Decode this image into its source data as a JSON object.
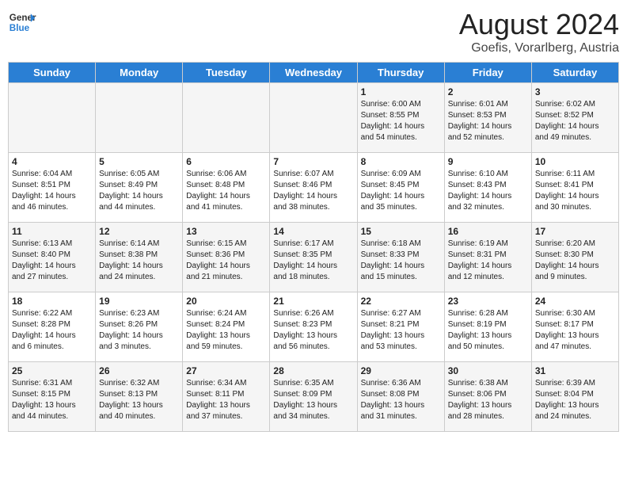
{
  "header": {
    "logo_line1": "General",
    "logo_line2": "Blue",
    "title": "August 2024",
    "subtitle": "Goefis, Vorarlberg, Austria"
  },
  "weekdays": [
    "Sunday",
    "Monday",
    "Tuesday",
    "Wednesday",
    "Thursday",
    "Friday",
    "Saturday"
  ],
  "weeks": [
    [
      {
        "day": "",
        "info": ""
      },
      {
        "day": "",
        "info": ""
      },
      {
        "day": "",
        "info": ""
      },
      {
        "day": "",
        "info": ""
      },
      {
        "day": "1",
        "info": "Sunrise: 6:00 AM\nSunset: 8:55 PM\nDaylight: 14 hours\nand 54 minutes."
      },
      {
        "day": "2",
        "info": "Sunrise: 6:01 AM\nSunset: 8:53 PM\nDaylight: 14 hours\nand 52 minutes."
      },
      {
        "day": "3",
        "info": "Sunrise: 6:02 AM\nSunset: 8:52 PM\nDaylight: 14 hours\nand 49 minutes."
      }
    ],
    [
      {
        "day": "4",
        "info": "Sunrise: 6:04 AM\nSunset: 8:51 PM\nDaylight: 14 hours\nand 46 minutes."
      },
      {
        "day": "5",
        "info": "Sunrise: 6:05 AM\nSunset: 8:49 PM\nDaylight: 14 hours\nand 44 minutes."
      },
      {
        "day": "6",
        "info": "Sunrise: 6:06 AM\nSunset: 8:48 PM\nDaylight: 14 hours\nand 41 minutes."
      },
      {
        "day": "7",
        "info": "Sunrise: 6:07 AM\nSunset: 8:46 PM\nDaylight: 14 hours\nand 38 minutes."
      },
      {
        "day": "8",
        "info": "Sunrise: 6:09 AM\nSunset: 8:45 PM\nDaylight: 14 hours\nand 35 minutes."
      },
      {
        "day": "9",
        "info": "Sunrise: 6:10 AM\nSunset: 8:43 PM\nDaylight: 14 hours\nand 32 minutes."
      },
      {
        "day": "10",
        "info": "Sunrise: 6:11 AM\nSunset: 8:41 PM\nDaylight: 14 hours\nand 30 minutes."
      }
    ],
    [
      {
        "day": "11",
        "info": "Sunrise: 6:13 AM\nSunset: 8:40 PM\nDaylight: 14 hours\nand 27 minutes."
      },
      {
        "day": "12",
        "info": "Sunrise: 6:14 AM\nSunset: 8:38 PM\nDaylight: 14 hours\nand 24 minutes."
      },
      {
        "day": "13",
        "info": "Sunrise: 6:15 AM\nSunset: 8:36 PM\nDaylight: 14 hours\nand 21 minutes."
      },
      {
        "day": "14",
        "info": "Sunrise: 6:17 AM\nSunset: 8:35 PM\nDaylight: 14 hours\nand 18 minutes."
      },
      {
        "day": "15",
        "info": "Sunrise: 6:18 AM\nSunset: 8:33 PM\nDaylight: 14 hours\nand 15 minutes."
      },
      {
        "day": "16",
        "info": "Sunrise: 6:19 AM\nSunset: 8:31 PM\nDaylight: 14 hours\nand 12 minutes."
      },
      {
        "day": "17",
        "info": "Sunrise: 6:20 AM\nSunset: 8:30 PM\nDaylight: 14 hours\nand 9 minutes."
      }
    ],
    [
      {
        "day": "18",
        "info": "Sunrise: 6:22 AM\nSunset: 8:28 PM\nDaylight: 14 hours\nand 6 minutes."
      },
      {
        "day": "19",
        "info": "Sunrise: 6:23 AM\nSunset: 8:26 PM\nDaylight: 14 hours\nand 3 minutes."
      },
      {
        "day": "20",
        "info": "Sunrise: 6:24 AM\nSunset: 8:24 PM\nDaylight: 13 hours\nand 59 minutes."
      },
      {
        "day": "21",
        "info": "Sunrise: 6:26 AM\nSunset: 8:23 PM\nDaylight: 13 hours\nand 56 minutes."
      },
      {
        "day": "22",
        "info": "Sunrise: 6:27 AM\nSunset: 8:21 PM\nDaylight: 13 hours\nand 53 minutes."
      },
      {
        "day": "23",
        "info": "Sunrise: 6:28 AM\nSunset: 8:19 PM\nDaylight: 13 hours\nand 50 minutes."
      },
      {
        "day": "24",
        "info": "Sunrise: 6:30 AM\nSunset: 8:17 PM\nDaylight: 13 hours\nand 47 minutes."
      }
    ],
    [
      {
        "day": "25",
        "info": "Sunrise: 6:31 AM\nSunset: 8:15 PM\nDaylight: 13 hours\nand 44 minutes."
      },
      {
        "day": "26",
        "info": "Sunrise: 6:32 AM\nSunset: 8:13 PM\nDaylight: 13 hours\nand 40 minutes."
      },
      {
        "day": "27",
        "info": "Sunrise: 6:34 AM\nSunset: 8:11 PM\nDaylight: 13 hours\nand 37 minutes."
      },
      {
        "day": "28",
        "info": "Sunrise: 6:35 AM\nSunset: 8:09 PM\nDaylight: 13 hours\nand 34 minutes."
      },
      {
        "day": "29",
        "info": "Sunrise: 6:36 AM\nSunset: 8:08 PM\nDaylight: 13 hours\nand 31 minutes."
      },
      {
        "day": "30",
        "info": "Sunrise: 6:38 AM\nSunset: 8:06 PM\nDaylight: 13 hours\nand 28 minutes."
      },
      {
        "day": "31",
        "info": "Sunrise: 6:39 AM\nSunset: 8:04 PM\nDaylight: 13 hours\nand 24 minutes."
      }
    ]
  ]
}
